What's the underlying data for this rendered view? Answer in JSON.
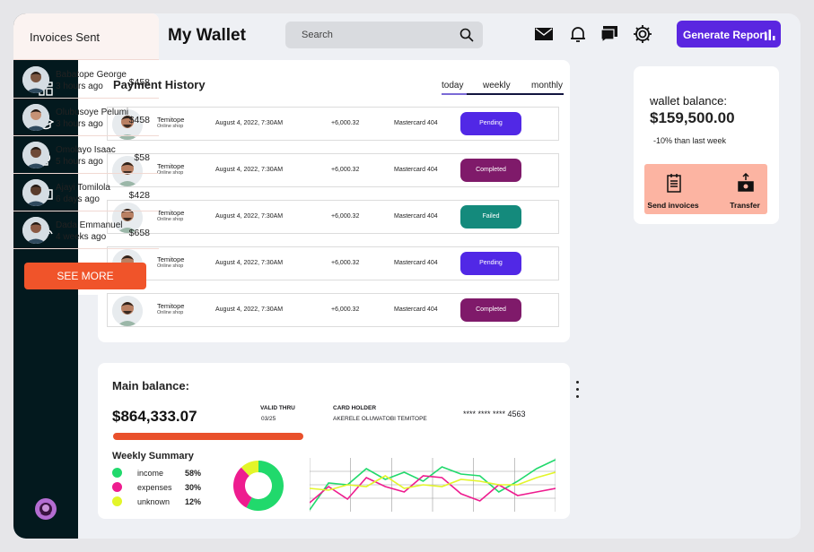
{
  "header": {
    "title": "My Wallet",
    "search_placeholder": "Search",
    "icons": [
      "mail-icon",
      "bell-icon",
      "chat-icon",
      "gear-icon"
    ],
    "generate_report_label": "Generate Report"
  },
  "sidebar": {
    "icons": [
      "dashboard-icon",
      "graduation-cap-icon",
      "lightbulb-icon",
      "message-icon",
      "signal-icon"
    ]
  },
  "payment_history": {
    "title": "Payment History",
    "tabs": [
      "today",
      "weekly",
      "monthly"
    ],
    "active_tab": "today",
    "rows": [
      {
        "name": "Temitope",
        "sub": "Online shop",
        "date": "August 4, 2022, 7:30AM",
        "amount": "+6,000.32",
        "card": "Mastercard 404",
        "status": "Pending",
        "status_color": "#5128e6"
      },
      {
        "name": "Temitope",
        "sub": "Online shop",
        "date": "August 4, 2022, 7:30AM",
        "amount": "+6,000.32",
        "card": "Mastercard 404",
        "status": "Completed",
        "status_color": "#7f1a6a"
      },
      {
        "name": "Temitope",
        "sub": "Online shop",
        "date": "August 4, 2022, 7:30AM",
        "amount": "+6,000.32",
        "card": "Mastercard 404",
        "status": "Failed",
        "status_color": "#148a7c"
      },
      {
        "name": "Temitope",
        "sub": "Online shop",
        "date": "August 4, 2022, 7:30AM",
        "amount": "+6,000.32",
        "card": "Mastercard 404",
        "status": "Pending",
        "status_color": "#5128e6"
      },
      {
        "name": "Temitope",
        "sub": "Online shop",
        "date": "August 4, 2022, 7:30AM",
        "amount": "+6,000.32",
        "card": "Mastercard 404",
        "status": "Completed",
        "status_color": "#7f1a6a"
      }
    ]
  },
  "main_balance": {
    "label": "Main balance:",
    "value": "$864,333.07",
    "valid_thru_label": "VALID THRU",
    "valid_thru_value": "03/25",
    "card_holder_label": "CARD HOLDER",
    "card_holder_value": "AKERELE OLUWATOBI TEMITOPE",
    "card_number": "**** **** **** 4563",
    "weekly_summary_title": "Weekly Summary",
    "legend": [
      {
        "name": "income",
        "percent": "58%",
        "color": "#21d96c"
      },
      {
        "name": "expenses",
        "percent": "30%",
        "color": "#ee1c8f"
      },
      {
        "name": "unknown",
        "percent": "12%",
        "color": "#e3f52a"
      }
    ]
  },
  "wallet": {
    "label": "wallet balance:",
    "value": "$159,500.00",
    "comparison": "-10% than last week",
    "actions": [
      {
        "label": "Send  invoices",
        "icon": "invoice-icon"
      },
      {
        "label": "Transfer",
        "icon": "transfer-icon"
      }
    ]
  },
  "invoices": {
    "title": "Invoices Sent",
    "items": [
      {
        "name": "Babatope George",
        "time": "3 hours ago",
        "amount": "$458"
      },
      {
        "name": "Olubusoye Pelumi",
        "time": "3 hours ago",
        "amount": "$458"
      },
      {
        "name": "Omolayo Isaac",
        "time": "5 hours ago",
        "amount": "$58"
      },
      {
        "name": "Ajayi Tomilola",
        "time": "6 days ago",
        "amount": "$428"
      },
      {
        "name": "Dada Emmanuel",
        "time": "4 weeks ago",
        "amount": "$658"
      }
    ],
    "see_more_label": "SEE MORE"
  },
  "chart_data": [
    {
      "type": "pie",
      "categories": [
        "income",
        "expenses",
        "unknown"
      ],
      "values": [
        58,
        30,
        12
      ]
    },
    {
      "type": "line",
      "x": [
        0,
        1,
        2,
        3,
        4,
        5,
        6,
        7,
        8,
        9,
        10,
        11,
        12,
        13
      ],
      "series": [
        {
          "values": [
            2,
            32,
            30,
            48,
            36,
            44,
            34,
            50,
            42,
            40,
            22,
            34,
            48,
            58
          ],
          "color": "#21d96c"
        },
        {
          "values": [
            10,
            28,
            14,
            38,
            28,
            22,
            40,
            38,
            20,
            12,
            30,
            18,
            22,
            26
          ],
          "color": "#ee1c8f"
        },
        {
          "values": [
            26,
            24,
            30,
            28,
            40,
            26,
            30,
            28,
            36,
            34,
            30,
            30,
            38,
            44
          ],
          "color": "#e3f52a"
        }
      ],
      "ylim": [
        0,
        60
      ]
    }
  ]
}
